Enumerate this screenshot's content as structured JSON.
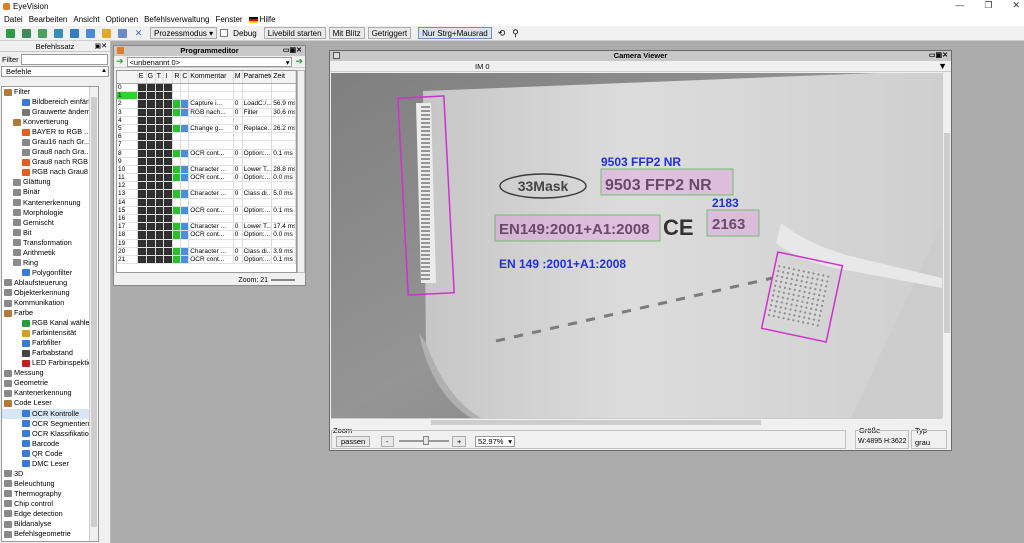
{
  "app": {
    "title": "EyeVision"
  },
  "menu": [
    "Datei",
    "Bearbeiten",
    "Ansicht",
    "Optionen",
    "Befehlsverwaltung",
    "Fenster",
    "Hilfe"
  ],
  "toolbar": {
    "mode": "Prozessmodus",
    "debug": "Debug",
    "live": "Livebild starten",
    "flash": "Mit Blitz",
    "triggered": "Getriggert",
    "strg": "Nur Strg+Mausrad"
  },
  "left": {
    "title": "Befehlssatz",
    "filter_label": "Filter",
    "header": "Befehle",
    "items": [
      {
        "label": "Filter",
        "lvl": 0,
        "c": "#b07a3a"
      },
      {
        "label": "Bildbereich einfärb...",
        "lvl": 2,
        "c": "#3a7bd5"
      },
      {
        "label": "Grauwerte ändern",
        "lvl": 2,
        "c": "#777"
      },
      {
        "label": "Konvertierung",
        "lvl": 1,
        "c": "#b07a3a"
      },
      {
        "label": "BAYER to RGB ...",
        "lvl": 2,
        "c": "#e06020"
      },
      {
        "label": "Grau16 nach Gr...",
        "lvl": 2,
        "c": "#888"
      },
      {
        "label": "Grau8 nach Gra...",
        "lvl": 2,
        "c": "#888"
      },
      {
        "label": "Grau8 nach RGB",
        "lvl": 2,
        "c": "#e06020"
      },
      {
        "label": "RGB nach Grau8",
        "lvl": 2,
        "c": "#e06020"
      },
      {
        "label": "Glättung",
        "lvl": 1,
        "c": "#8a8a8a"
      },
      {
        "label": "Binär",
        "lvl": 1,
        "c": "#8a8a8a"
      },
      {
        "label": "Kantenerkennung",
        "lvl": 1,
        "c": "#8a8a8a"
      },
      {
        "label": "Morphologie",
        "lvl": 1,
        "c": "#8a8a8a"
      },
      {
        "label": "Gemischt",
        "lvl": 1,
        "c": "#8a8a8a"
      },
      {
        "label": "Bit",
        "lvl": 1,
        "c": "#8a8a8a"
      },
      {
        "label": "Transformation",
        "lvl": 1,
        "c": "#8a8a8a"
      },
      {
        "label": "Arithmetik",
        "lvl": 1,
        "c": "#8a8a8a"
      },
      {
        "label": "Ring",
        "lvl": 1,
        "c": "#8a8a8a"
      },
      {
        "label": "Polygonfilter",
        "lvl": 2,
        "c": "#3a7bd5"
      },
      {
        "label": "Ablaufsteuerung",
        "lvl": 0,
        "c": "#8a8a8a"
      },
      {
        "label": "Objekterkennung",
        "lvl": 0,
        "c": "#8a8a8a"
      },
      {
        "label": "Kommunikation",
        "lvl": 0,
        "c": "#8a8a8a"
      },
      {
        "label": "Farbe",
        "lvl": 0,
        "c": "#b07a3a"
      },
      {
        "label": "RGB Kanal wählen",
        "lvl": 2,
        "c": "#2a9a3a"
      },
      {
        "label": "Farbintensität",
        "lvl": 2,
        "c": "#d0a020"
      },
      {
        "label": "Farbfilter",
        "lvl": 2,
        "c": "#3a7bd5"
      },
      {
        "label": "Farbabstand",
        "lvl": 2,
        "c": "#444"
      },
      {
        "label": "LED Farbinspektion",
        "lvl": 2,
        "c": "#c02020"
      },
      {
        "label": "Messung",
        "lvl": 0,
        "c": "#8a8a8a"
      },
      {
        "label": "Geometrie",
        "lvl": 0,
        "c": "#8a8a8a"
      },
      {
        "label": "Kantenerkennung",
        "lvl": 0,
        "c": "#8a8a8a"
      },
      {
        "label": "Code Leser",
        "lvl": 0,
        "c": "#b07a3a"
      },
      {
        "label": "OCR Kontrolle",
        "lvl": 2,
        "c": "#3a7bd5",
        "sel": true
      },
      {
        "label": "OCR Segmentieru...",
        "lvl": 2,
        "c": "#3a7bd5"
      },
      {
        "label": "OCR Klassifikation",
        "lvl": 2,
        "c": "#3a7bd5"
      },
      {
        "label": "Barcode",
        "lvl": 2,
        "c": "#3a7bd5"
      },
      {
        "label": "QR Code",
        "lvl": 2,
        "c": "#3a7bd5"
      },
      {
        "label": "DMC Leser",
        "lvl": 2,
        "c": "#3a7bd5"
      },
      {
        "label": "3D",
        "lvl": 0,
        "c": "#8a8a8a"
      },
      {
        "label": "Beleuchtung",
        "lvl": 0,
        "c": "#8a8a8a"
      },
      {
        "label": "Thermography",
        "lvl": 0,
        "c": "#8a8a8a"
      },
      {
        "label": "Chip control",
        "lvl": 0,
        "c": "#8a8a8a"
      },
      {
        "label": "Edge detection",
        "lvl": 0,
        "c": "#8a8a8a"
      },
      {
        "label": "Bildanalyse",
        "lvl": 0,
        "c": "#8a8a8a"
      },
      {
        "label": "Befehlsgeometrie",
        "lvl": 0,
        "c": "#8a8a8a"
      }
    ]
  },
  "prog": {
    "title": "Programmeditor",
    "combo": "<unbenannt 0>",
    "zoom": "Zoom: 21",
    "headers": [
      "",
      "E",
      "G",
      "T",
      "I",
      "R",
      "C",
      "Kommentar",
      "M",
      "Parameter",
      "Zeit"
    ],
    "rows": [
      [
        "0",
        "",
        "",
        "",
        "",
        "",
        "",
        "",
        "",
        "",
        ""
      ],
      [
        "1",
        "",
        "",
        "",
        "",
        "",
        "",
        "",
        "",
        "",
        ""
      ],
      [
        "2",
        "",
        "",
        "",
        "",
        "",
        "",
        "Capture i...",
        "0",
        "LoadC:/...",
        "56.9 ms"
      ],
      [
        "3",
        "",
        "",
        "",
        "",
        "",
        "",
        "RGB nach...",
        "0",
        "Filter",
        "30.6 ms"
      ],
      [
        "4",
        "",
        "",
        "",
        "",
        "",
        "",
        "",
        "",
        "",
        ""
      ],
      [
        "5",
        "",
        "",
        "",
        "",
        "",
        "",
        "Change g...",
        "0",
        "Replace...",
        "26.2 ms"
      ],
      [
        "6",
        "",
        "",
        "",
        "",
        "",
        "",
        "",
        "",
        "",
        ""
      ],
      [
        "7",
        "",
        "",
        "",
        "",
        "",
        "",
        "",
        "",
        "",
        ""
      ],
      [
        "8",
        "",
        "",
        "",
        "",
        "",
        "",
        "OCR cont...",
        "0",
        "Option:...",
        "0.1 ms"
      ],
      [
        "9",
        "",
        "",
        "",
        "",
        "",
        "",
        "",
        "",
        "",
        ""
      ],
      [
        "10",
        "",
        "",
        "",
        "",
        "",
        "",
        "Character ...",
        "0",
        "Lower T...",
        "28.8 ms"
      ],
      [
        "11",
        "",
        "",
        "",
        "",
        "",
        "",
        "OCR cont...",
        "0",
        "Option:...",
        "0.0 ms"
      ],
      [
        "12",
        "",
        "",
        "",
        "",
        "",
        "",
        "",
        "",
        "",
        ""
      ],
      [
        "13",
        "",
        "",
        "",
        "",
        "",
        "",
        "Character ...",
        "0",
        "Class di...",
        "5.0 ms"
      ],
      [
        "14",
        "",
        "",
        "",
        "",
        "",
        "",
        "",
        "",
        "",
        ""
      ],
      [
        "15",
        "",
        "",
        "",
        "",
        "",
        "",
        "OCR cont...",
        "0",
        "Option:...",
        "0.1 ms"
      ],
      [
        "16",
        "",
        "",
        "",
        "",
        "",
        "",
        "",
        "",
        "",
        ""
      ],
      [
        "17",
        "",
        "",
        "",
        "",
        "",
        "",
        "Character ...",
        "0",
        "Lower T...",
        "17.4 ms"
      ],
      [
        "18",
        "",
        "",
        "",
        "",
        "",
        "",
        "OCR cont...",
        "0",
        "Option:...",
        "0.0 ms"
      ],
      [
        "19",
        "",
        "",
        "",
        "",
        "",
        "",
        "",
        "",
        "",
        ""
      ],
      [
        "20",
        "",
        "",
        "",
        "",
        "",
        "",
        "Character ...",
        "0",
        "Class di...",
        "3.9 ms"
      ],
      [
        "21",
        "",
        "",
        "",
        "",
        "",
        "",
        "OCR cont...",
        "0",
        "Option:...",
        "0.1 ms"
      ]
    ]
  },
  "cam": {
    "title": "Camera Viewer",
    "im": "IM 0",
    "labels": {
      "l1": "9503 FFP2 NR",
      "l2": "2183",
      "l3": "EN 149 :2001+A1:2008"
    },
    "print": {
      "mask": "33Mask",
      "t1": "9503 FFP2 NR",
      "t2": "EN149:2001+A1:2008",
      "ce": "CE",
      "t3": "2163"
    },
    "zoom_group": "Zoom",
    "passen": "passen",
    "minus": "-",
    "plus": "+",
    "zoom_value": "52.97%",
    "size_group": "Größe",
    "size_value": "W:4895  H:3622",
    "type_group": "Typ",
    "type_value": "grau"
  }
}
